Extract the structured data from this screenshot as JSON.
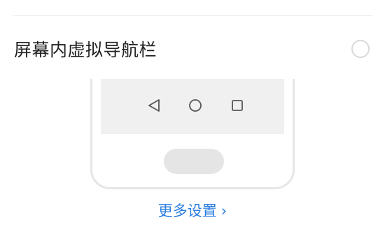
{
  "option": {
    "label": "屏幕内虚拟导航栏",
    "selected": false
  },
  "illustration": {
    "nav_icons": [
      "back-triangle-icon",
      "home-circle-icon",
      "recent-apps-square-icon"
    ]
  },
  "more_settings": {
    "label": "更多设置",
    "chevron": "›"
  },
  "colors": {
    "link": "#2a7de1",
    "text": "#222222",
    "nav_bar_bg": "#f0f0f0"
  }
}
